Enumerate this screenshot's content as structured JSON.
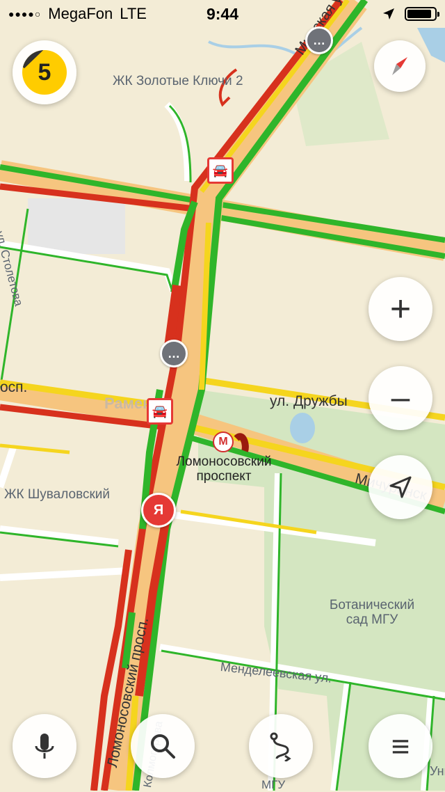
{
  "status_bar": {
    "signal": "●●●●○",
    "carrier": "MegaFon",
    "network": "LTE",
    "time": "9:44",
    "battery_percent": 90
  },
  "traffic_score": "5",
  "labels": {
    "zk_zolotye": "ЖК Золотые Ключи 2",
    "minskaya": "Минская ул.",
    "stoletova": "ул. Столетова",
    "prosp_left": "осп.",
    "ramenki": "Раменки",
    "druzhby": "ул. Дружбы",
    "metro_name": "Ломоносовский проспект",
    "zk_shuvalovsky": "ЖК Шуваловский",
    "michurinsky": "Мичуринск",
    "botanical": "Ботанический сад МГУ",
    "mendeleevskaya": "Менделеевская ул.",
    "lomonosovsky": "Ломоносовский просп.",
    "kolmogorova": "Колмогорова",
    "mgu": "МГУ",
    "nive": "Униве"
  },
  "markers": {
    "chat": "…",
    "accident": "🚘",
    "ya": "Я",
    "metro": "М"
  },
  "buttons": {
    "zoom_in": "+",
    "zoom_out": "–",
    "menu": "≡"
  },
  "colors": {
    "traffic_green": "#2fb52a",
    "traffic_yellow": "#f5d51e",
    "traffic_red": "#d7311d",
    "traffic_dark_red": "#9a1a0e",
    "road_fill": "#f6c57f",
    "park": "#d4e6c1",
    "water": "#a9cfe6",
    "background": "#f3ecd6"
  }
}
